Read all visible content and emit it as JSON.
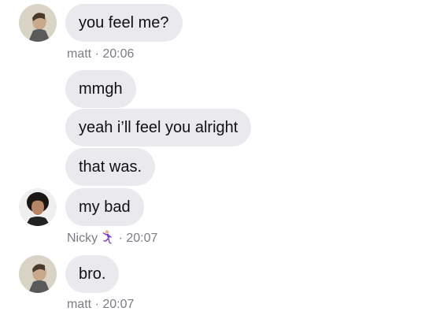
{
  "messages": [
    {
      "sender": "matt",
      "text": "you feel me?"
    },
    {
      "sender": "Nicky",
      "text": "mmgh"
    },
    {
      "sender": "Nicky",
      "text": "yeah i’ll feel you alright"
    },
    {
      "sender": "Nicky",
      "text": "that was."
    },
    {
      "sender": "Nicky",
      "text": "my bad"
    },
    {
      "sender": "matt",
      "text": "bro."
    }
  ],
  "meta": [
    {
      "name": "matt",
      "separator": "·",
      "time": "20:06"
    },
    {
      "name": "Nicky",
      "emoji": "man-dancing-emoji",
      "separator": "·",
      "time": "20:07"
    },
    {
      "name": "matt",
      "separator": "·",
      "time": "20:07"
    }
  ],
  "colors": {
    "bubble": "#e9e9ee",
    "meta_text": "#7c7c86",
    "text": "#111111"
  }
}
